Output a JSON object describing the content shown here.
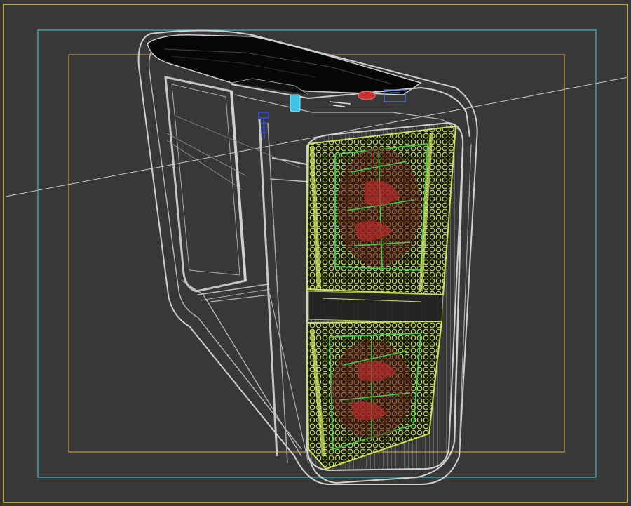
{
  "viewport": {
    "background": "#383838",
    "active_border_color": "#b8a23c",
    "safe_frame_outer_color": "#3fb9c4",
    "safe_frame_inner_color": "#c99a2e",
    "horizon_color": "#c8c8c8",
    "wire_color": "#d0d0d0",
    "fan_mesh_color": "#c8e05a",
    "fan_blade_color": "#c0302a",
    "fan_frame_color": "#42d04a"
  },
  "model": {
    "object": "pc-tower-case",
    "render_mode": "wireframe",
    "parts": [
      "front-bezel",
      "top-panel",
      "side-frame",
      "upper-front-fan",
      "lower-front-fan",
      "power-button",
      "usb-port",
      "screw"
    ]
  }
}
